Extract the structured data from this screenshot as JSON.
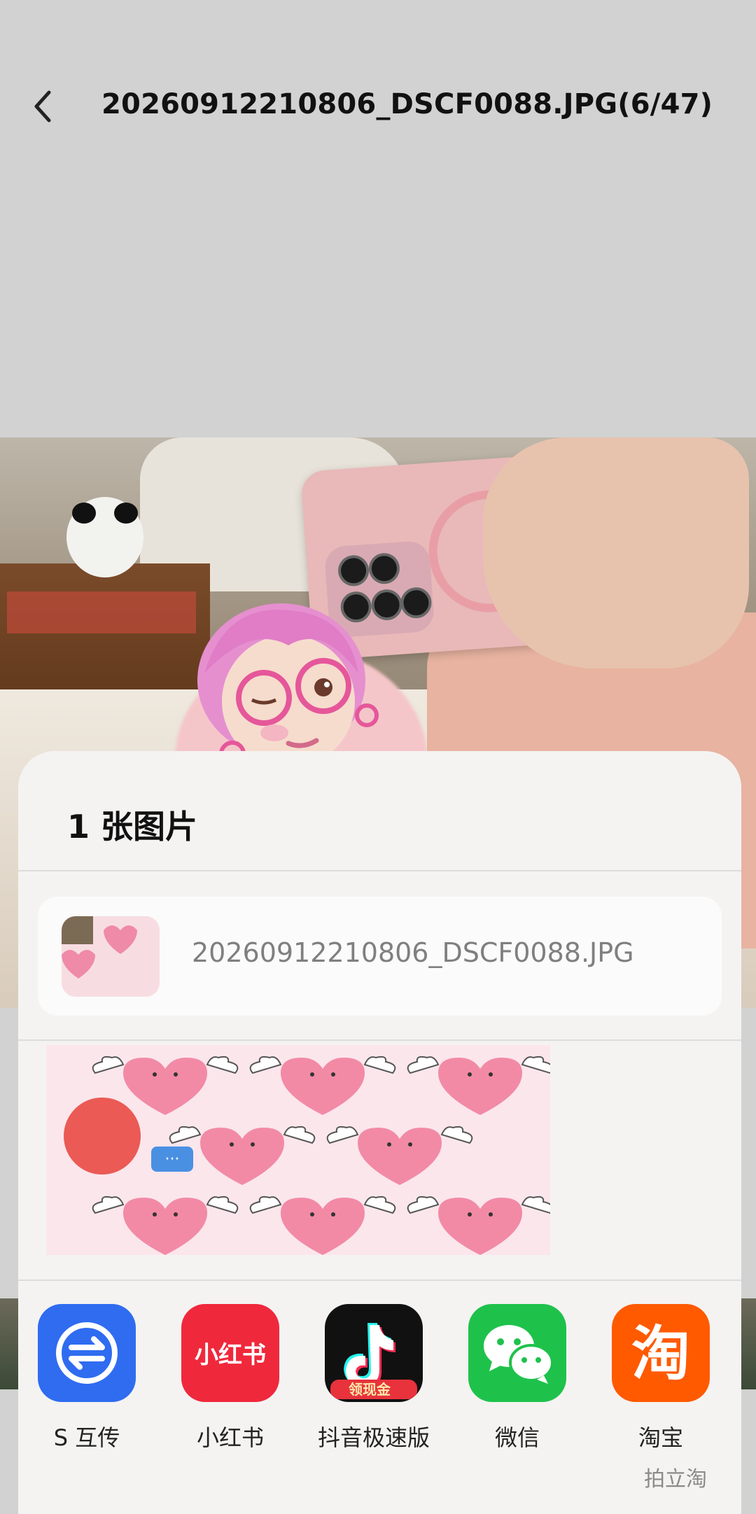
{
  "header": {
    "title": "20260912210806_DSCF0088.JPG(6/47)"
  },
  "share_sheet": {
    "title": "1 张图片",
    "file": {
      "name": "20260912210806_DSCF0088.JPG"
    },
    "contacts": {
      "badge": "···"
    },
    "apps": [
      {
        "label": "S 互传",
        "icon": "transfer-icon",
        "color": "#2f6cf0"
      },
      {
        "label": "小红书",
        "icon": "xiaohongshu-icon",
        "color": "#f0283c"
      },
      {
        "label": "抖音极速版",
        "icon": "douyin-icon",
        "color": "#111111",
        "badge": "领现金"
      },
      {
        "label": "微信",
        "icon": "wechat-icon",
        "color": "#1ec24b"
      },
      {
        "label": "淘宝",
        "icon": "taobao-icon",
        "color": "#ff5a00"
      }
    ]
  },
  "watermark": "拍立淘"
}
